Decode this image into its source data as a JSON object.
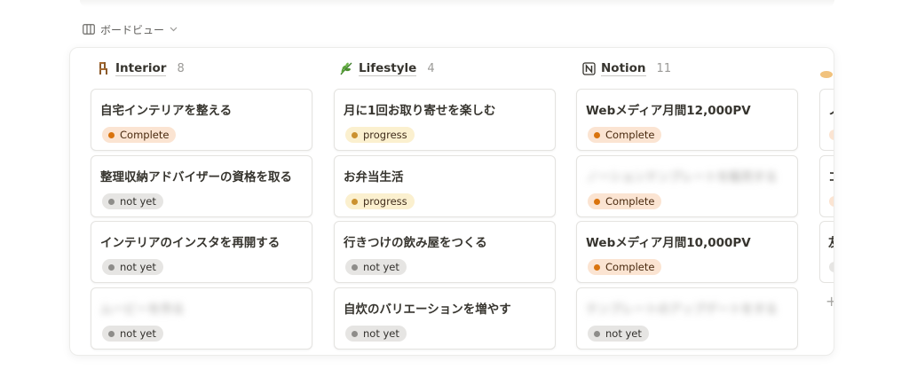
{
  "view": {
    "label": "ボードビュー"
  },
  "columns": [
    {
      "name": "Interior",
      "count": "8",
      "icon": "chair-icon",
      "cards": [
        {
          "title": "自宅インテリアを整える",
          "status": "Complete",
          "status_kind": "complete",
          "blurred": false
        },
        {
          "title": "整理収納アドバイザーの資格を取る",
          "status": "not yet",
          "status_kind": "notyet",
          "blurred": false
        },
        {
          "title": "インテリアのインスタを再開する",
          "status": "not yet",
          "status_kind": "notyet",
          "blurred": false
        },
        {
          "title": "ムービーを作る",
          "status": "not yet",
          "status_kind": "notyet",
          "blurred": true
        }
      ]
    },
    {
      "name": "Lifestyle",
      "count": "4",
      "icon": "herb-icon",
      "cards": [
        {
          "title": "月に1回お取り寄せを楽しむ",
          "status": "progress",
          "status_kind": "progress",
          "blurred": false
        },
        {
          "title": "お弁当生活",
          "status": "progress",
          "status_kind": "progress",
          "blurred": false
        },
        {
          "title": "行きつけの飲み屋をつくる",
          "status": "not yet",
          "status_kind": "notyet",
          "blurred": false
        },
        {
          "title": "自炊のバリエーションを増やす",
          "status": "not yet",
          "status_kind": "notyet",
          "blurred": false
        }
      ]
    },
    {
      "name": "Notion",
      "count": "11",
      "icon": "notion-icon",
      "cards": [
        {
          "title": "Webメディア月間12,000PV",
          "status": "Complete",
          "status_kind": "complete",
          "blurred": false
        },
        {
          "title": "ノーションテンプレートを販売する",
          "status": "Complete",
          "status_kind": "complete",
          "blurred": true
        },
        {
          "title": "Webメディア月間10,000PV",
          "status": "Complete",
          "status_kind": "complete",
          "blurred": false
        },
        {
          "title": "テンプレートのアップデートをする",
          "status": "not yet",
          "status_kind": "notyet",
          "blurred": true
        }
      ]
    }
  ],
  "partial_column": {
    "chars": [
      "ノ",
      "コ",
      "友"
    ]
  },
  "colors": {
    "complete_bg": "#fbe4d2",
    "complete_dot": "#d9730d",
    "progress_bg": "#fbf0cf",
    "progress_dot": "#cb912f",
    "notyet_bg": "#e6e5e3",
    "notyet_dot": "#8e8d8a"
  }
}
